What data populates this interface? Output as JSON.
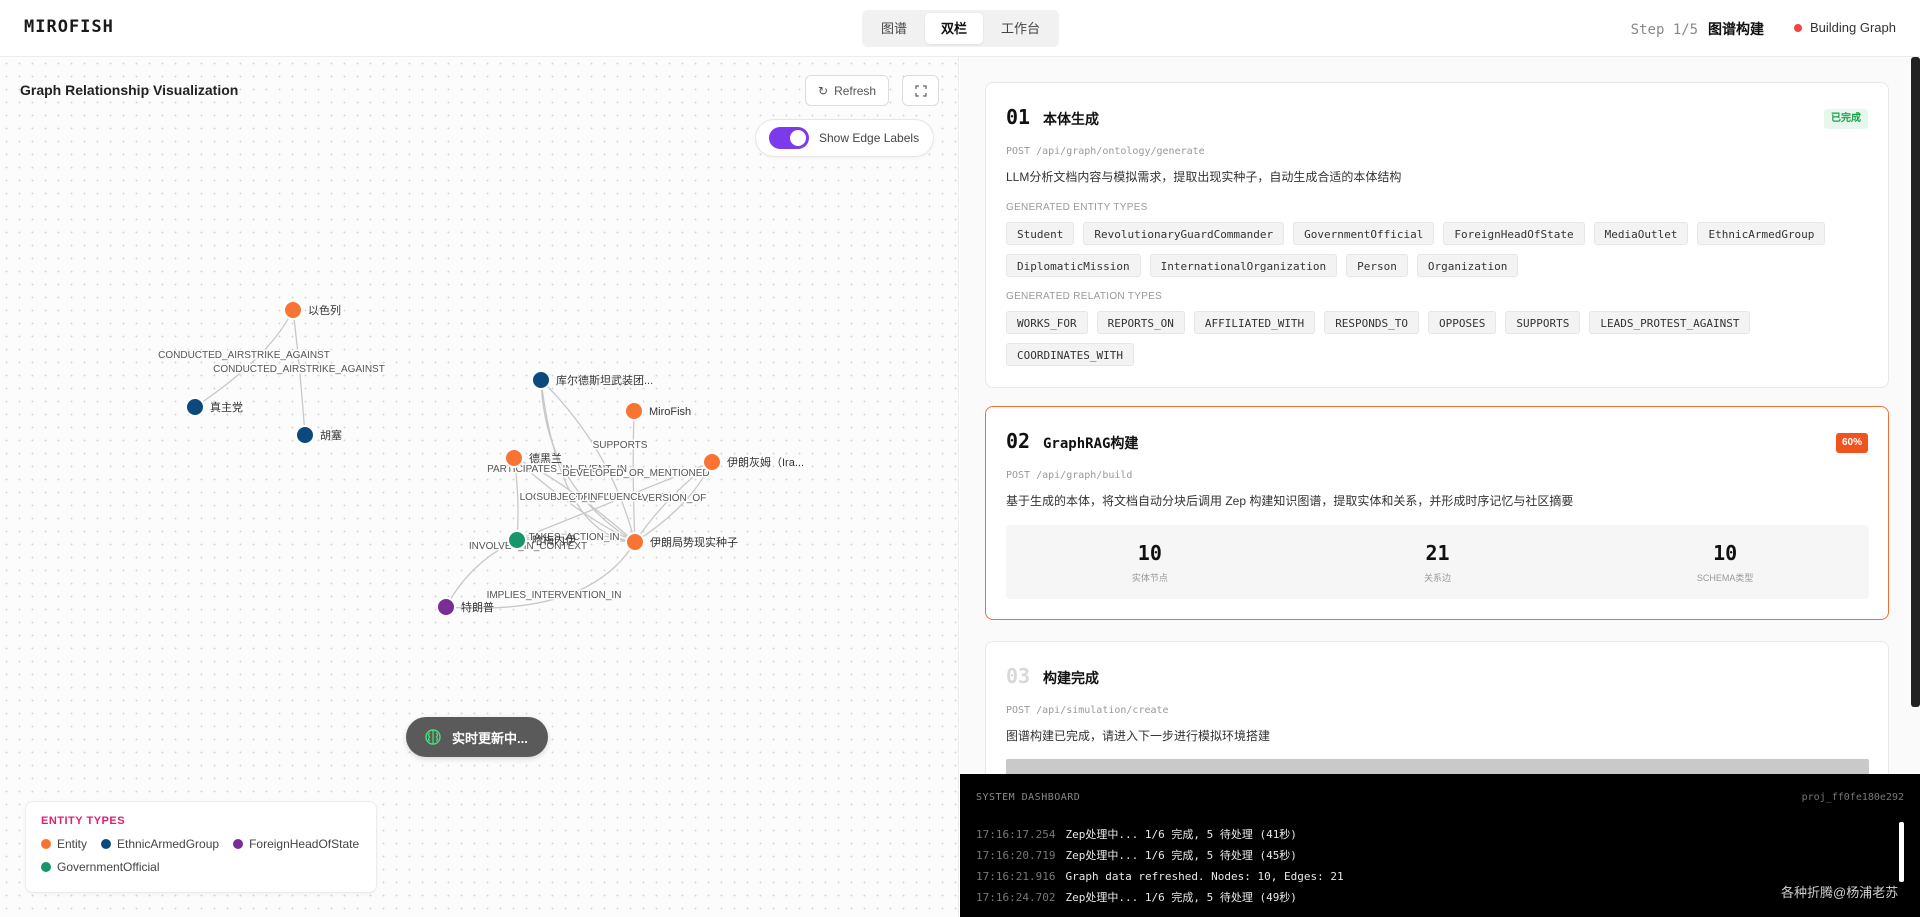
{
  "header": {
    "brand": "MIROFISH",
    "view_tabs": [
      {
        "label": "图谱",
        "active": false
      },
      {
        "label": "双栏",
        "active": true
      },
      {
        "label": "工作台",
        "active": false
      }
    ],
    "step": "Step 1/5",
    "step_name": "图谱构建",
    "status": "Building Graph",
    "status_color": "#ef4444"
  },
  "graph_panel": {
    "title": "Graph Relationship Visualization",
    "refresh_label": "Refresh",
    "edge_toggle_label": "Show Edge Labels",
    "edge_labels_on": true,
    "live_label": "实时更新中...",
    "legend": {
      "title": "ENTITY TYPES",
      "items": [
        {
          "label": "Entity",
          "color": "#f97332"
        },
        {
          "label": "EthnicArmedGroup",
          "color": "#0c4a7e"
        },
        {
          "label": "ForeignHeadOfState",
          "color": "#7b2d96"
        },
        {
          "label": "GovernmentOfficial",
          "color": "#17956b"
        }
      ]
    }
  },
  "graph": {
    "nodes": [
      {
        "id": "israel",
        "label": "以色列",
        "type": "Entity"
      },
      {
        "id": "zhenzhu",
        "label": "真主党",
        "type": "EthnicArmedGroup"
      },
      {
        "id": "husai",
        "label": "胡塞",
        "type": "EthnicArmedGroup"
      },
      {
        "id": "kurd",
        "label": "库尔德斯坦武装团...",
        "type": "EthnicArmedGroup"
      },
      {
        "id": "mirofish",
        "label": "MiroFish",
        "type": "Entity"
      },
      {
        "id": "tehran",
        "label": "德黑兰",
        "type": "Entity"
      },
      {
        "id": "irgc",
        "label": "伊朗灰姆（Ira...",
        "type": "Entity"
      },
      {
        "id": "khamenei",
        "label": "哈梅内伊",
        "type": "GovernmentOfficial"
      },
      {
        "id": "seed",
        "label": "伊朗局势现实种子",
        "type": "Entity"
      },
      {
        "id": "trump",
        "label": "特朗普",
        "type": "ForeignHeadOfState"
      }
    ],
    "edges": [
      {
        "label": "CONDUCTED_AIRSTRIKE_AGAINST"
      },
      {
        "label": "CONDUCTED_AIRSTRIKE_AGAINST"
      },
      {
        "label": "SUPPORTS"
      },
      {
        "label": "PARTICIPATES_IN_EVENT_IN"
      },
      {
        "label": "DEVELOPED_OR_MENTIONED"
      },
      {
        "label": "LOCATION_OF_EVENT"
      },
      {
        "label": "SUBJECT_INFLUENCE_OF"
      },
      {
        "label": "VERSION_OF"
      },
      {
        "label": "TAKES_ACTION_IN"
      },
      {
        "label": "INVOLVES_IN_CONTEXT"
      },
      {
        "label": "IMPLIES_INTERVENTION_IN"
      }
    ]
  },
  "steps": [
    {
      "num": "01",
      "title": "本体生成",
      "badge": "已完成",
      "endpoint": "POST /api/graph/ontology/generate",
      "desc": "LLM分析文档内容与模拟需求，提取出现实种子，自动生成合适的本体结构",
      "entity_types_label": "GENERATED ENTITY TYPES",
      "entity_types": [
        "Student",
        "RevolutionaryGuardCommander",
        "GovernmentOfficial",
        "ForeignHeadOfState",
        "MediaOutlet",
        "EthnicArmedGroup",
        "DiplomaticMission",
        "InternationalOrganization",
        "Person",
        "Organization"
      ],
      "relation_types_label": "GENERATED RELATION TYPES",
      "relation_types": [
        "WORKS_FOR",
        "REPORTS_ON",
        "AFFILIATED_WITH",
        "RESPONDS_TO",
        "OPPOSES",
        "SUPPORTS",
        "LEADS_PROTEST_AGAINST",
        "COORDINATES_WITH"
      ]
    },
    {
      "num": "02",
      "title": "GraphRAG构建",
      "badge": "60%",
      "endpoint": "POST /api/graph/build",
      "desc": "基于生成的本体，将文档自动分块后调用 Zep 构建知识图谱，提取实体和关系，并形成时序记忆与社区摘要",
      "stats": [
        {
          "value": "10",
          "label": "实体节点"
        },
        {
          "value": "21",
          "label": "关系边"
        },
        {
          "value": "10",
          "label": "SCHEMA类型"
        }
      ]
    },
    {
      "num": "03",
      "title": "构建完成",
      "endpoint": "POST /api/simulation/create",
      "desc": "图谱构建已完成，请进入下一步进行模拟环境搭建",
      "progress": 1.0
    }
  ],
  "dashboard": {
    "title": "SYSTEM DASHBOARD",
    "project": "proj_ff0fe180e292",
    "logs": [
      {
        "time": "17:16:17.254",
        "msg": "Zep处理中... 1/6 完成, 5 待处理 (41秒)"
      },
      {
        "time": "17:16:20.719",
        "msg": "Zep处理中... 1/6 完成, 5 待处理 (45秒)"
      },
      {
        "time": "17:16:21.916",
        "msg": "Graph data refreshed. Nodes: 10, Edges: 21"
      },
      {
        "time": "17:16:24.702",
        "msg": "Zep处理中... 1/6 完成, 5 待处理 (49秒)"
      }
    ]
  },
  "watermark": "各种折腾@杨浦老苏"
}
